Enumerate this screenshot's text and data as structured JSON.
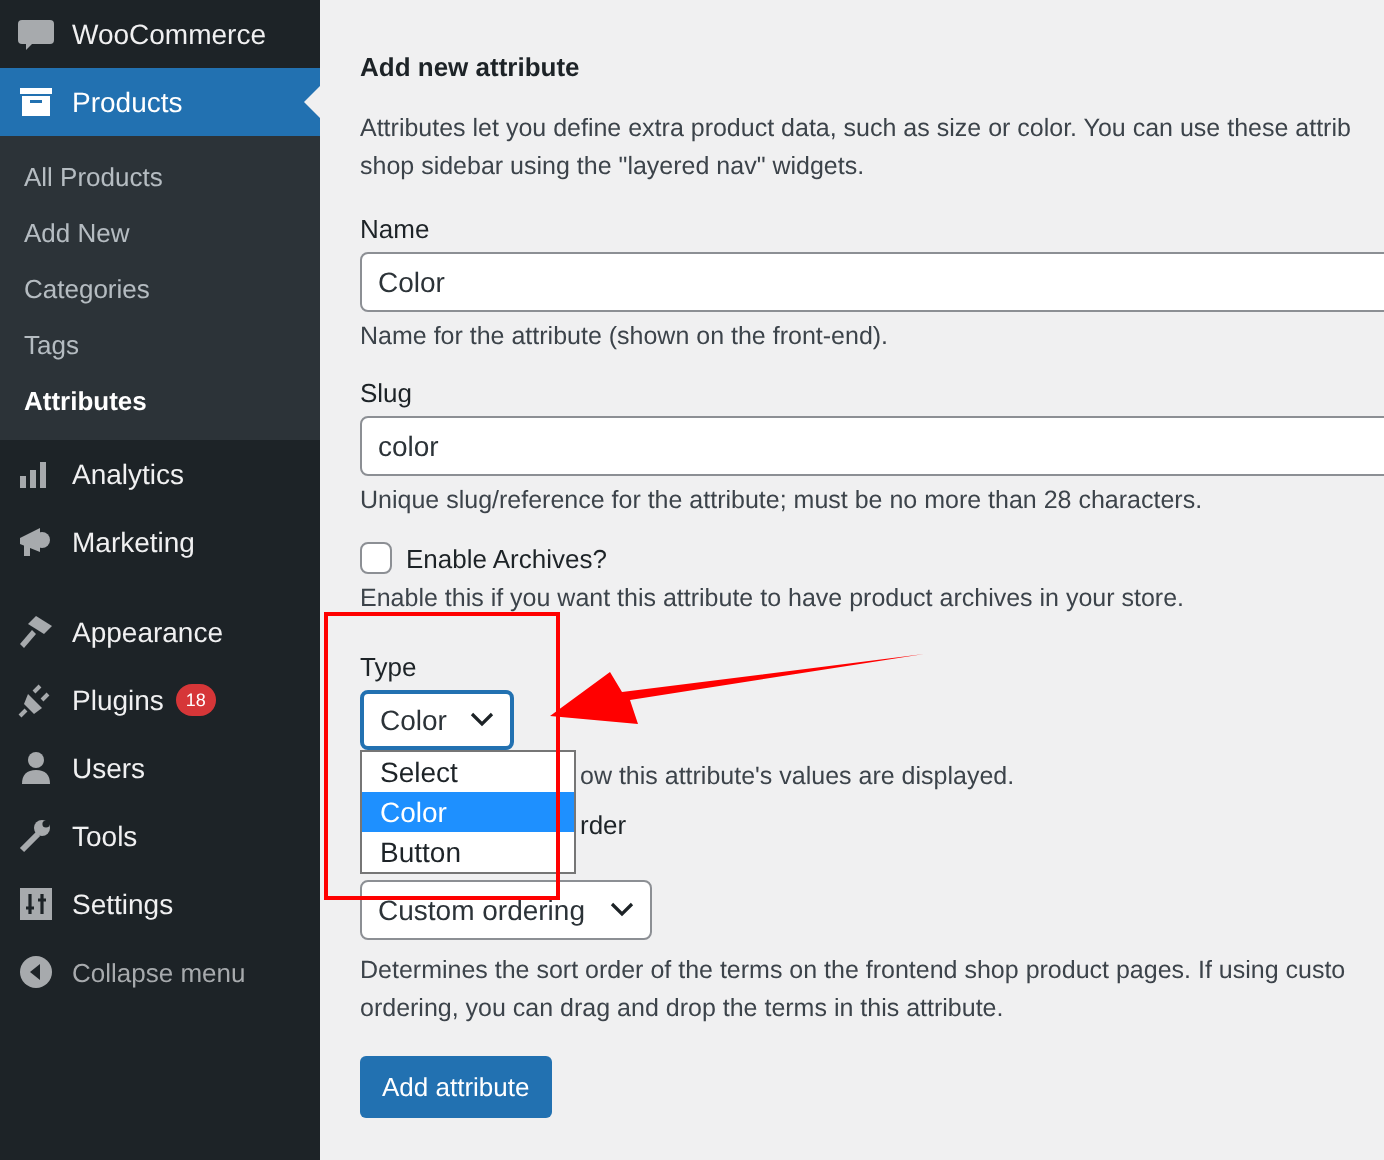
{
  "sidebar": {
    "top_item": {
      "label": "WooCommerce"
    },
    "items": [
      {
        "label": "Products",
        "kind": "current",
        "selected": true,
        "children": [
          {
            "label": "All Products",
            "selected": false
          },
          {
            "label": "Add New",
            "selected": false
          },
          {
            "label": "Categories",
            "selected": false
          },
          {
            "label": "Tags",
            "selected": false
          },
          {
            "label": "Attributes",
            "selected": true
          }
        ]
      },
      {
        "label": "Analytics",
        "kind": "chart",
        "selected": false
      },
      {
        "label": "Marketing",
        "kind": "megaphone",
        "selected": false
      },
      {
        "label": "Appearance",
        "kind": "brush",
        "selected": false
      },
      {
        "label": "Plugins",
        "kind": "plug",
        "selected": false,
        "badge": "18"
      },
      {
        "label": "Users",
        "kind": "person",
        "selected": false
      },
      {
        "label": "Tools",
        "kind": "wrench",
        "selected": false
      },
      {
        "label": "Settings",
        "kind": "sliders",
        "selected": false
      }
    ],
    "collapse": {
      "label": "Collapse menu"
    }
  },
  "form": {
    "title": "Add new attribute",
    "intro": [
      "Attributes let you define extra product data, such as size or color. You can use these attrib",
      "shop sidebar using the \"layered nav\" widgets."
    ],
    "name": {
      "label": "Name",
      "value": "Color",
      "hint": "Name for the attribute (shown on the front-end)."
    },
    "slug": {
      "label": "Slug",
      "value": "color",
      "hint": "Unique slug/reference for the attribute; must be no more than 28 characters."
    },
    "archives": {
      "label": "Enable Archives?",
      "checked": false,
      "hint": "Enable this if you want this attribute to have product archives in your store."
    },
    "type": {
      "label": "Type",
      "value": "Color",
      "expanded": true,
      "options": [
        {
          "label": "Select",
          "selected": false
        },
        {
          "label": "Color",
          "selected": true
        },
        {
          "label": "Button",
          "selected": false
        }
      ],
      "hint": "ow this attribute's values are displayed."
    },
    "order": {
      "label": "rder",
      "value": "Custom ordering",
      "hint": [
        "Determines the sort order of the terms on the frontend shop product pages. If using custo",
        "ordering, you can drag and drop the terms in this attribute."
      ]
    },
    "submit": "Add attribute"
  }
}
